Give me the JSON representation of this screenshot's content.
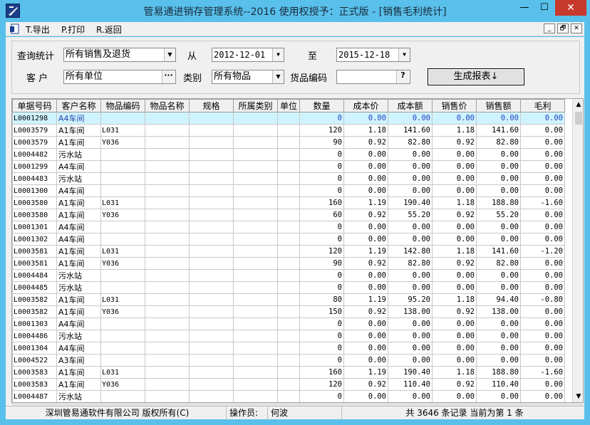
{
  "window": {
    "title": "管易通进销存管理系统--2016  使用权授予：正式版 - [销售毛利统计]",
    "controls": {
      "minimize": "—",
      "maximize": "☐",
      "close": "✕"
    }
  },
  "menu": {
    "items": [
      "T.导出",
      "P.打印",
      "R.返回"
    ],
    "mdi_controls": [
      "_",
      "🗗",
      "✕"
    ]
  },
  "filters": {
    "query_label": "查询统计",
    "query_value": "所有销售及退货",
    "from_label": "从",
    "from_date": "2012-12-01",
    "to_label": "至",
    "to_date": "2015-12-18",
    "customer_label": "客  户",
    "customer_value": "所有单位",
    "category_label": "类别",
    "category_value": "所有物品",
    "item_code_label": "货品编码",
    "item_code_value": "",
    "lookup_button": "?",
    "customer_lookup": "···",
    "generate_button": "生成报表↓"
  },
  "grid": {
    "columns": [
      "单据号码",
      "客户名称",
      "物品编码",
      "物品名称",
      "规格",
      "所属类别",
      "单位",
      "数量",
      "成本价",
      "成本额",
      "销售价",
      "销售额",
      "毛利"
    ],
    "rows": [
      [
        "L0001298",
        "A4车间",
        "",
        "",
        "",
        "",
        "",
        "0",
        "0.00",
        "0.00",
        "0.00",
        "0.00",
        "0.00"
      ],
      [
        "L0003579",
        "A1车间",
        "L031",
        "",
        "",
        "",
        "",
        "120",
        "1.18",
        "141.60",
        "1.18",
        "141.60",
        "0.00"
      ],
      [
        "L0003579",
        "A1车间",
        "Y036",
        "",
        "",
        "",
        "",
        "90",
        "0.92",
        "82.80",
        "0.92",
        "82.80",
        "0.00"
      ],
      [
        "L0004482",
        "污水站",
        "",
        "",
        "",
        "",
        "",
        "0",
        "0.00",
        "0.00",
        "0.00",
        "0.00",
        "0.00"
      ],
      [
        "L0001299",
        "A4车间",
        "",
        "",
        "",
        "",
        "",
        "0",
        "0.00",
        "0.00",
        "0.00",
        "0.00",
        "0.00"
      ],
      [
        "L0004483",
        "污水站",
        "",
        "",
        "",
        "",
        "",
        "0",
        "0.00",
        "0.00",
        "0.00",
        "0.00",
        "0.00"
      ],
      [
        "L0001300",
        "A4车间",
        "",
        "",
        "",
        "",
        "",
        "0",
        "0.00",
        "0.00",
        "0.00",
        "0.00",
        "0.00"
      ],
      [
        "L0003580",
        "A1车间",
        "L031",
        "",
        "",
        "",
        "",
        "160",
        "1.19",
        "190.40",
        "1.18",
        "188.80",
        "-1.60"
      ],
      [
        "L0003580",
        "A1车间",
        "Y036",
        "",
        "",
        "",
        "",
        "60",
        "0.92",
        "55.20",
        "0.92",
        "55.20",
        "0.00"
      ],
      [
        "L0001301",
        "A4车间",
        "",
        "",
        "",
        "",
        "",
        "0",
        "0.00",
        "0.00",
        "0.00",
        "0.00",
        "0.00"
      ],
      [
        "L0001302",
        "A4车间",
        "",
        "",
        "",
        "",
        "",
        "0",
        "0.00",
        "0.00",
        "0.00",
        "0.00",
        "0.00"
      ],
      [
        "L0003581",
        "A1车间",
        "L031",
        "",
        "",
        "",
        "",
        "120",
        "1.19",
        "142.80",
        "1.18",
        "141.60",
        "-1.20"
      ],
      [
        "L0003581",
        "A1车间",
        "Y036",
        "",
        "",
        "",
        "",
        "90",
        "0.92",
        "82.80",
        "0.92",
        "82.80",
        "0.00"
      ],
      [
        "L0004484",
        "污水站",
        "",
        "",
        "",
        "",
        "",
        "0",
        "0.00",
        "0.00",
        "0.00",
        "0.00",
        "0.00"
      ],
      [
        "L0004485",
        "污水站",
        "",
        "",
        "",
        "",
        "",
        "0",
        "0.00",
        "0.00",
        "0.00",
        "0.00",
        "0.00"
      ],
      [
        "L0003582",
        "A1车间",
        "L031",
        "",
        "",
        "",
        "",
        "80",
        "1.19",
        "95.20",
        "1.18",
        "94.40",
        "-0.80"
      ],
      [
        "L0003582",
        "A1车间",
        "Y036",
        "",
        "",
        "",
        "",
        "150",
        "0.92",
        "138.00",
        "0.92",
        "138.00",
        "0.00"
      ],
      [
        "L0001303",
        "A4车间",
        "",
        "",
        "",
        "",
        "",
        "0",
        "0.00",
        "0.00",
        "0.00",
        "0.00",
        "0.00"
      ],
      [
        "L0004486",
        "污水站",
        "",
        "",
        "",
        "",
        "",
        "0",
        "0.00",
        "0.00",
        "0.00",
        "0.00",
        "0.00"
      ],
      [
        "L0001304",
        "A4车间",
        "",
        "",
        "",
        "",
        "",
        "0",
        "0.00",
        "0.00",
        "0.00",
        "0.00",
        "0.00"
      ],
      [
        "L0004522",
        "A3车间",
        "",
        "",
        "",
        "",
        "",
        "0",
        "0.00",
        "0.00",
        "0.00",
        "0.00",
        "0.00"
      ],
      [
        "L0003583",
        "A1车间",
        "L031",
        "",
        "",
        "",
        "",
        "160",
        "1.19",
        "190.40",
        "1.18",
        "188.80",
        "-1.60"
      ],
      [
        "L0003583",
        "A1车间",
        "Y036",
        "",
        "",
        "",
        "",
        "120",
        "0.92",
        "110.40",
        "0.92",
        "110.40",
        "0.00"
      ],
      [
        "L0004487",
        "污水站",
        "",
        "",
        "",
        "",
        "",
        "0",
        "0.00",
        "0.00",
        "0.00",
        "0.00",
        "0.00"
      ]
    ]
  },
  "status": {
    "company": "深圳管易通软件有限公司 版权所有(C)",
    "operator_label": "操作员:",
    "operator_name": "何波",
    "records": "共 3646 条记录 当前为第 1 条"
  },
  "colors": {
    "title_bar": "#58c0ea",
    "close_button": "#c7392c",
    "selected_row": "#cff3ff",
    "selected_text": "#1f44c0"
  }
}
